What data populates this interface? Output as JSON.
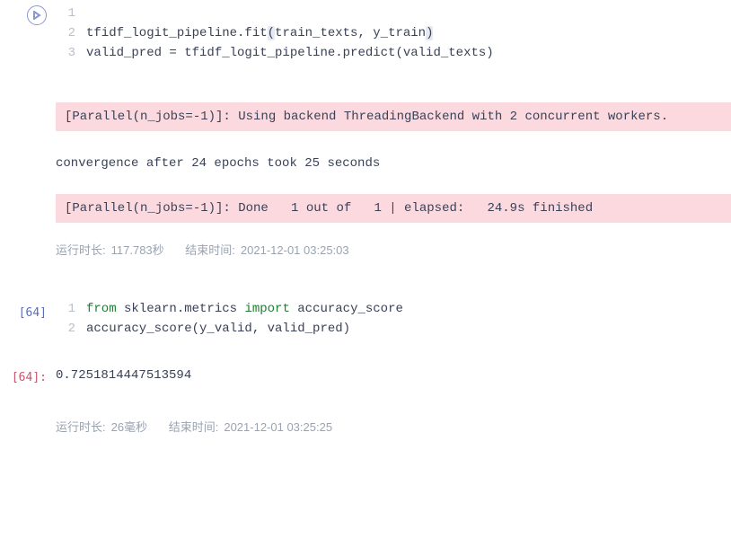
{
  "cell1": {
    "lines": [
      "1",
      "2",
      "3"
    ],
    "code_l2a": "tfidf_logit_pipeline.fit",
    "code_l2b": "(",
    "code_l2c": "train_texts, y_train",
    "code_l2d": ")",
    "code_l3": "valid_pred = tfidf_logit_pipeline.predict(valid_texts)",
    "out1": "[Parallel(n_jobs=-1)]: Using backend ThreadingBackend with 2 concurrent workers.",
    "out2": "convergence after 24 epochs took 25 seconds",
    "out3": "[Parallel(n_jobs=-1)]: Done   1 out of   1 | elapsed:   24.9s finished",
    "meta_rt_lbl": "运行时长:",
    "meta_rt_val": "117.783秒",
    "meta_end_lbl": "结束时间:",
    "meta_end_val": "2021-12-01 03:25:03"
  },
  "cell2": {
    "prompt_in": "[64]",
    "lines": [
      "1",
      "2"
    ],
    "l1_from": "from",
    "l1_mod": " sklearn.metrics ",
    "l1_import": "import",
    "l1_name": " accuracy_score",
    "l2": "accuracy_score(y_valid, valid_pred)",
    "prompt_out": "[64]:",
    "result": "0.7251814447513594",
    "meta_rt_lbl": "运行时长:",
    "meta_rt_val": "26毫秒",
    "meta_end_lbl": "结束时间:",
    "meta_end_val": "2021-12-01 03:25:25"
  }
}
